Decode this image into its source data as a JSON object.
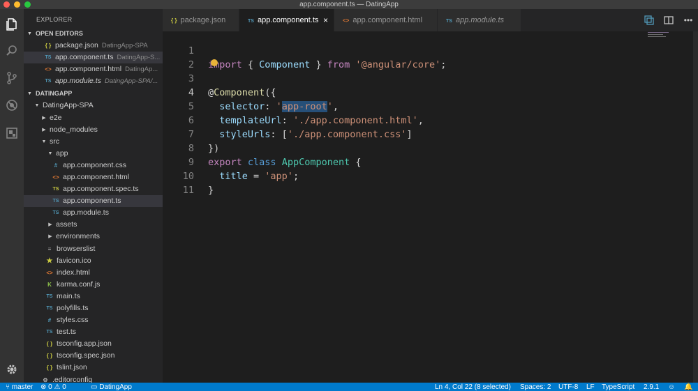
{
  "window": {
    "title": "app.component.ts — DatingApp"
  },
  "explorer": {
    "title": "EXPLORER",
    "open_editors_label": "OPEN EDITORS",
    "open_editors": [
      {
        "icon": "{ }",
        "name": "package.json",
        "desc": "DatingApp-SPA"
      },
      {
        "icon": "TS",
        "name": "app.component.ts",
        "desc": "DatingApp-S..."
      },
      {
        "icon": "<>",
        "name": "app.component.html",
        "desc": "DatingAp..."
      },
      {
        "icon": "TS",
        "name": "app.module.ts",
        "desc": "DatingApp-SPA/..."
      }
    ],
    "workspace_label": "DATINGAPP",
    "tree": [
      {
        "name": "DatingApp-SPA"
      },
      {
        "name": "e2e"
      },
      {
        "name": "node_modules"
      },
      {
        "name": "src"
      },
      {
        "name": "app"
      },
      {
        "icon": "#",
        "name": "app.component.css"
      },
      {
        "icon": "<>",
        "name": "app.component.html"
      },
      {
        "icon": "TS",
        "name": "app.component.spec.ts"
      },
      {
        "icon": "TS",
        "name": "app.component.ts"
      },
      {
        "icon": "TS",
        "name": "app.module.ts"
      },
      {
        "name": "assets"
      },
      {
        "name": "environments"
      },
      {
        "icon": "≡",
        "name": "browserslist"
      },
      {
        "icon": "★",
        "name": "favicon.ico"
      },
      {
        "icon": "<>",
        "name": "index.html"
      },
      {
        "icon": "K",
        "name": "karma.conf.js"
      },
      {
        "icon": "TS",
        "name": "main.ts"
      },
      {
        "icon": "TS",
        "name": "polyfills.ts"
      },
      {
        "icon": "#",
        "name": "styles.css"
      },
      {
        "icon": "TS",
        "name": "test.ts"
      },
      {
        "icon": "{ }",
        "name": "tsconfig.app.json"
      },
      {
        "icon": "{ }",
        "name": "tsconfig.spec.json"
      },
      {
        "icon": "{ }",
        "name": "tslint.json"
      },
      {
        "icon": "⚙",
        "name": ".editorconfig"
      }
    ]
  },
  "tabs": [
    {
      "icon": "{ }",
      "label": "package.json"
    },
    {
      "icon": "TS",
      "label": "app.component.ts",
      "close": "×"
    },
    {
      "icon": "<>",
      "label": "app.component.html"
    },
    {
      "icon": "TS",
      "label": "app.module.ts"
    }
  ],
  "editor": {
    "line_numbers": [
      "1",
      "2",
      "3",
      "4",
      "5",
      "6",
      "7",
      "8",
      "9",
      "10",
      "11"
    ],
    "lines": {
      "l1": {
        "a": "import",
        "b": " { ",
        "c": "Component",
        "d": " } ",
        "e": "from",
        "f": " ",
        "g": "'@angular/core'",
        "h": ";"
      },
      "l3": {
        "a": "@",
        "b": "Component",
        "c": "({"
      },
      "l4": {
        "a": "selector",
        "b": ": ",
        "c": "'",
        "d": "app-root",
        "e": "'",
        "f": ","
      },
      "l5": {
        "a": "templateUrl",
        "b": ": ",
        "c": "'./app.component.html'",
        "d": ","
      },
      "l6": {
        "a": "styleUrls",
        "b": ": [",
        "c": "'./app.component.css'",
        "d": "]"
      },
      "l7": {
        "a": "})"
      },
      "l8": {
        "a": "export",
        "b": " ",
        "c": "class",
        "d": " ",
        "e": "AppComponent",
        "f": " {"
      },
      "l9": {
        "a": "title",
        "b": " = ",
        "c": "'app'",
        "d": ";"
      },
      "l10": {
        "a": "}"
      }
    }
  },
  "statusbar": {
    "branch": "master",
    "errors": "0",
    "warnings": "0",
    "folder": "DatingApp",
    "position": "Ln 4, Col 22 (8 selected)",
    "spaces": "Spaces: 2",
    "encoding": "UTF-8",
    "eol": "LF",
    "language": "TypeScript",
    "version": "2.9.1"
  }
}
